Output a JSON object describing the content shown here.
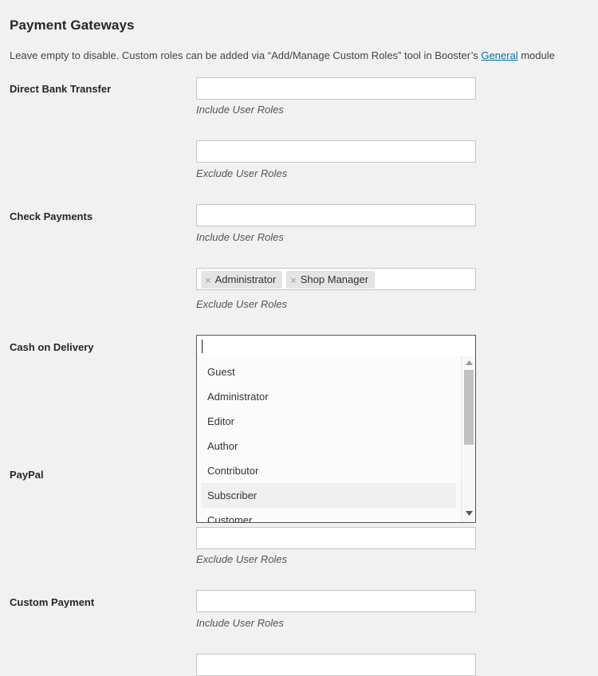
{
  "page": {
    "title": "Payment Gateways",
    "description_before_link": "Leave empty to disable. Custom roles can be added via “Add/Manage Custom Roles” tool in Booster’s ",
    "description_link": "General",
    "description_after_link": " module",
    "link_color": "#0073aa",
    "background_color": "#f1f1f1"
  },
  "labels": {
    "include_user_roles": "Include User Roles",
    "exclude_user_roles": "Exclude User Roles"
  },
  "gateways": [
    {
      "name": "Direct Bank Transfer"
    },
    {
      "name": "Check Payments"
    },
    {
      "name": "Cash on Delivery"
    },
    {
      "name": "PayPal"
    },
    {
      "name": "Custom Payment"
    }
  ],
  "fields": {
    "bank_include": {
      "value": ""
    },
    "bank_exclude": {
      "value": ""
    },
    "check_include": {
      "value": ""
    },
    "check_exclude": {
      "chips": [
        {
          "label": "Administrator",
          "remove_icon": "close-icon",
          "remove_glyph": "×"
        },
        {
          "label": "Shop Manager",
          "remove_icon": "close-icon",
          "remove_glyph": "×"
        }
      ]
    },
    "cod_include": {
      "value": "",
      "focused": true
    },
    "paypal_exclude": {
      "value": ""
    },
    "custom_include": {
      "value": ""
    },
    "custom_exclude": {
      "value": ""
    }
  },
  "dropdown": {
    "options": [
      "Guest",
      "Administrator",
      "Editor",
      "Author",
      "Contributor",
      "Subscriber",
      "Customer"
    ],
    "highlighted_option": "Subscriber",
    "highlight_color": "#f0f0f0",
    "scrollbar": {
      "up_icon": "triangle-up-icon",
      "down_icon": "triangle-down-icon",
      "thumb_color": "#c1c1c1"
    }
  }
}
